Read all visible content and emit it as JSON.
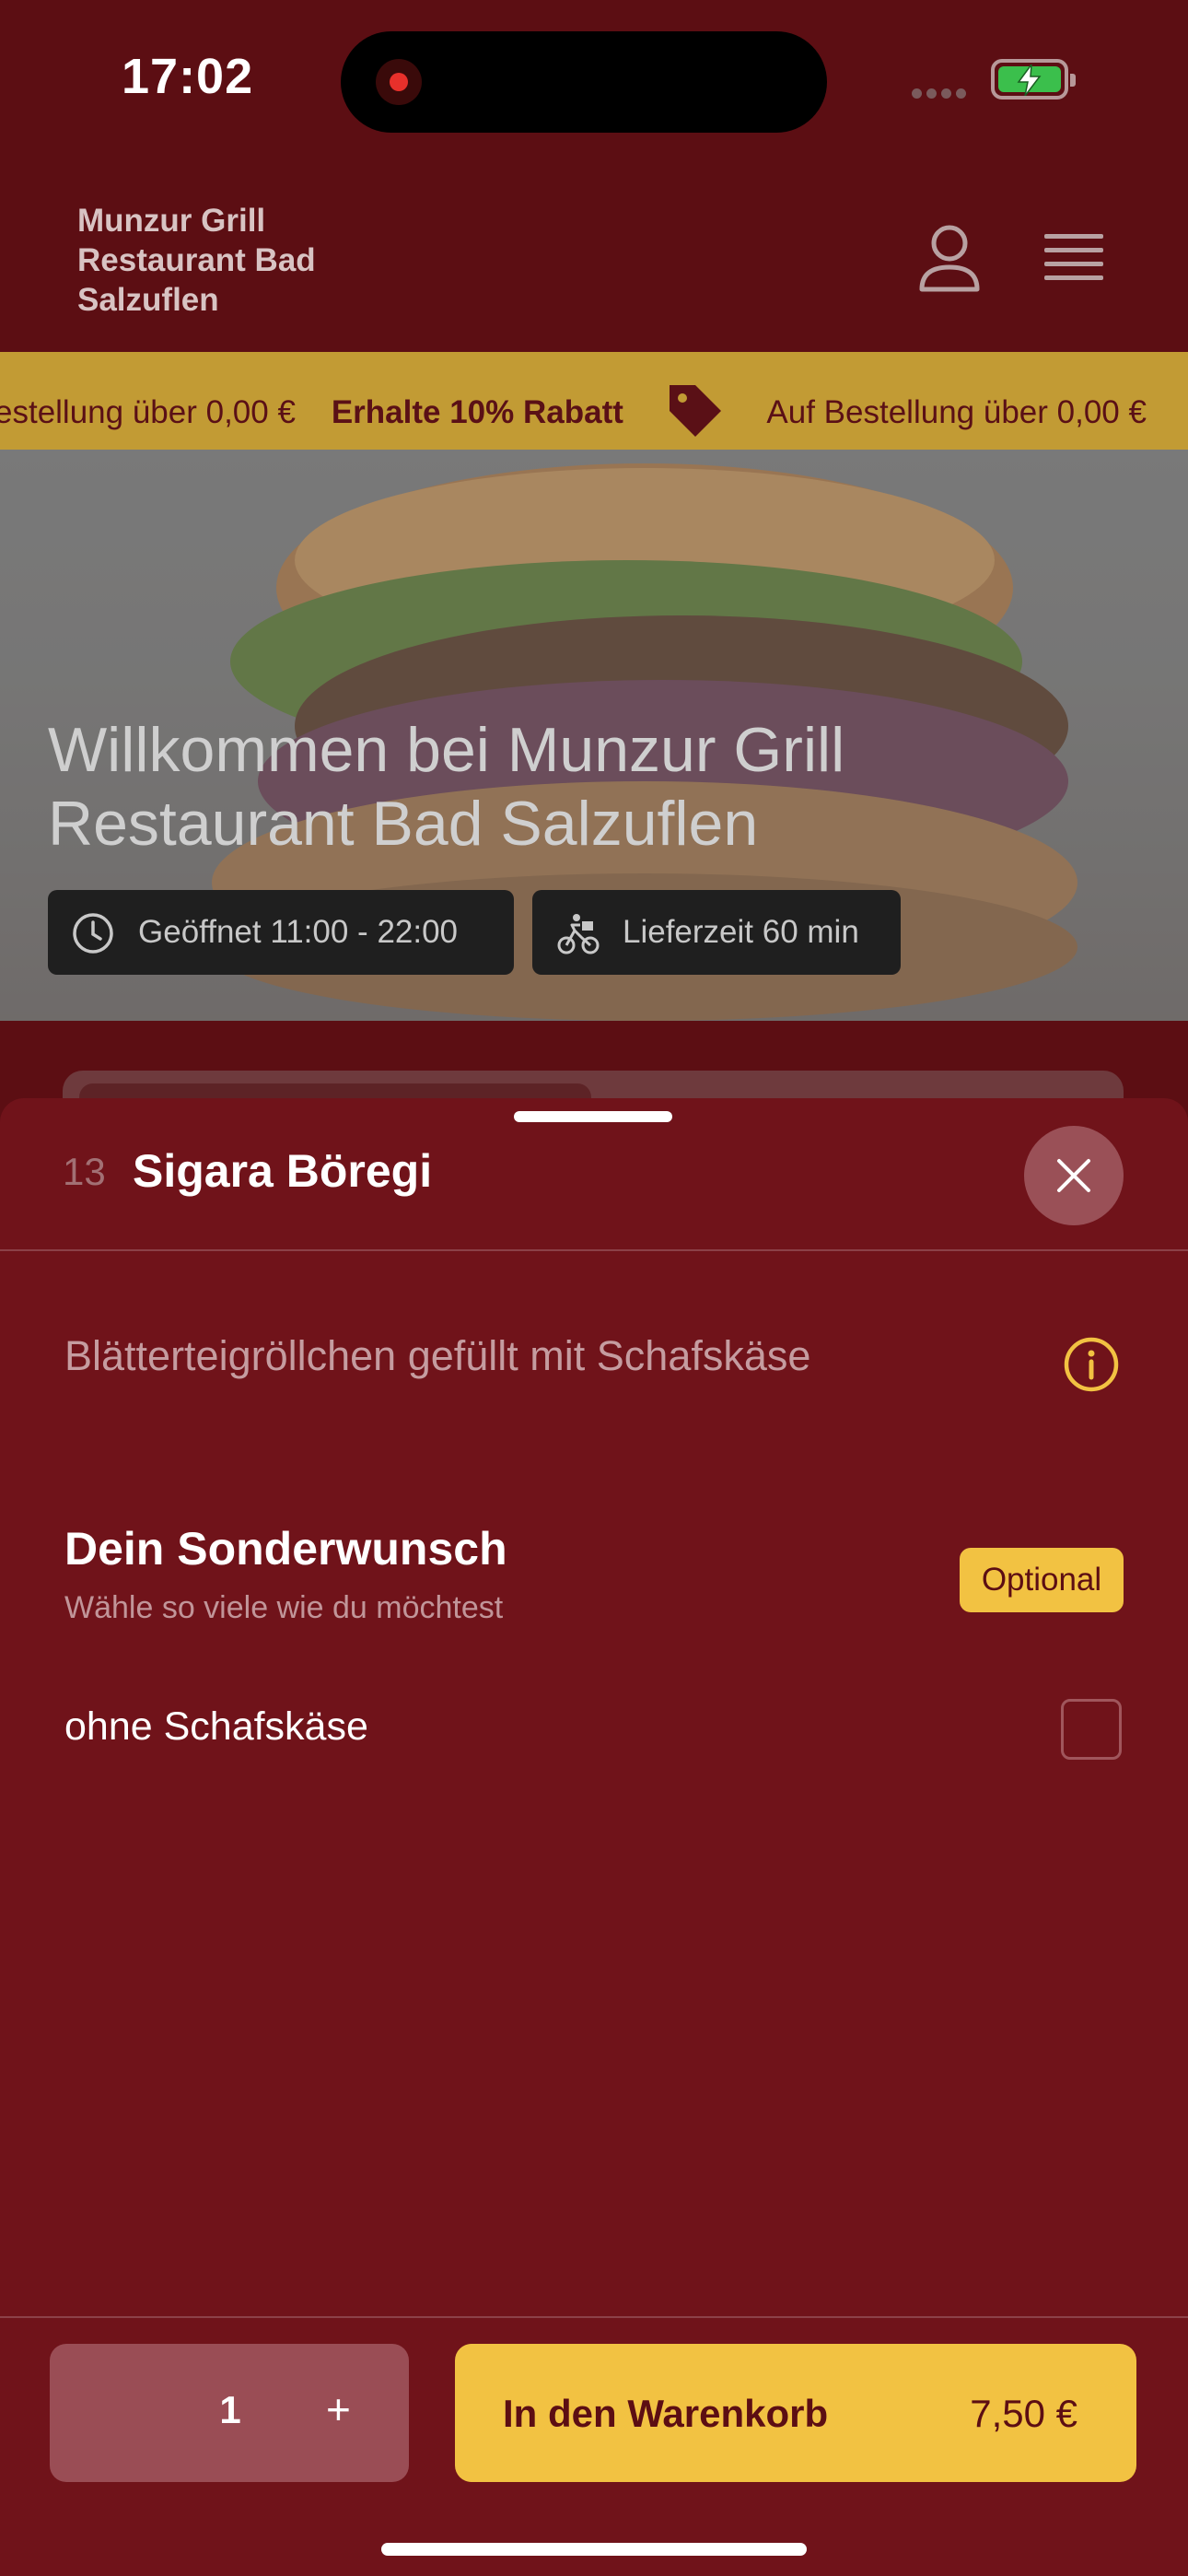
{
  "status_bar": {
    "time": "17:02"
  },
  "header": {
    "brand": "Munzur Grill Restaurant Bad Salzuflen"
  },
  "promo": {
    "text_before": "estellung über 0,00 €",
    "bold": "Erhalte 10% Rabatt",
    "text_after": "Auf Bestellung über 0,00 €"
  },
  "hero": {
    "title": "Willkommen bei Munzur Grill Restaurant Bad Salzuflen",
    "opening_hours": "Geöffnet 11:00 - 22:00",
    "delivery_time": "Lieferzeit 60 min"
  },
  "sheet": {
    "item_number": "13",
    "item_title": "Sigara Böregi",
    "description": "Blätterteigröllchen gefüllt mit Schafskäse",
    "section_title": "Dein Sonderwunsch",
    "section_subtitle": "Wähle so viele wie du möchtest",
    "optional_badge": "Optional",
    "options": [
      {
        "label": "ohne Schafskäse",
        "checked": false
      }
    ]
  },
  "footer": {
    "quantity": "1",
    "plus": "+",
    "cart_label": "In den Warenkorb",
    "price": "7,50 €"
  },
  "colors": {
    "background": "#5c0e13",
    "sheet": "#70131a",
    "accent": "#f2c242",
    "promo": "#c29b34"
  }
}
